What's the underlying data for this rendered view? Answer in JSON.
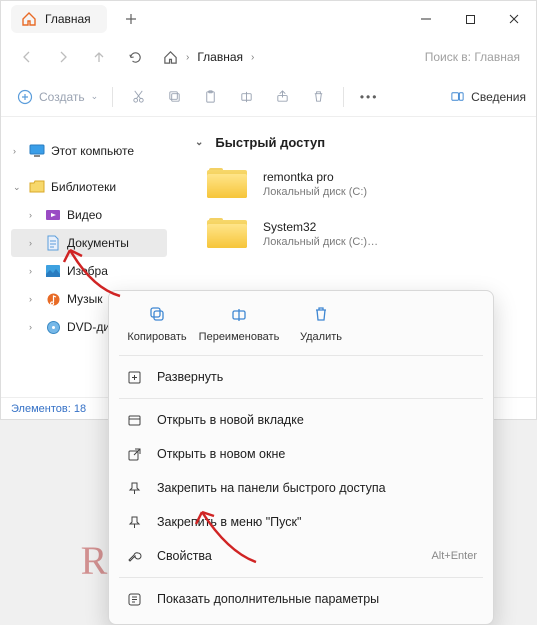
{
  "title": "Главная",
  "breadcrumb": {
    "current": "Главная"
  },
  "search": {
    "placeholder": "Поиск в: Главная"
  },
  "toolbar": {
    "create": "Создать"
  },
  "details_label": "Сведения",
  "sidebar": {
    "this_pc": "Этот компьюте",
    "libraries": "Библиотеки",
    "video": "Видео",
    "documents": "Документы",
    "images": "Изобра",
    "music": "Музык",
    "dvd": "DVD-дис"
  },
  "section_title": "Быстрый доступ",
  "items": [
    {
      "name": "remontka pro",
      "sub": "Локальный диск (C:)"
    },
    {
      "name": "System32",
      "sub": "Локальный диск (C:)…"
    }
  ],
  "status": "Элементов: 18",
  "ctx": {
    "copy": "Копировать",
    "rename": "Переименовать",
    "delete": "Удалить",
    "expand": "Развернуть",
    "open_tab": "Открыть в новой вкладке",
    "open_win": "Открыть в новом окне",
    "pin_quick": "Закрепить на панели быстрого доступа",
    "pin_start": "Закрепить в меню \"Пуск\"",
    "properties": "Свойства",
    "shortcut": "Alt+Enter",
    "more": "Показать дополнительные параметры"
  },
  "watermark": "REMONTKA.COM"
}
